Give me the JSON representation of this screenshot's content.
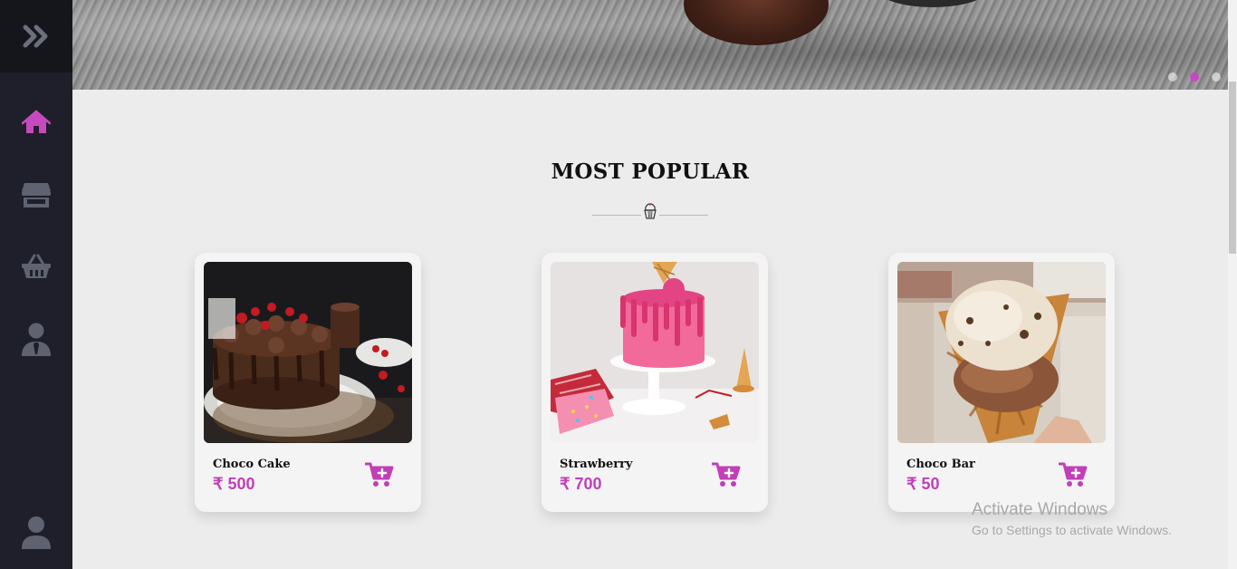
{
  "sidebar": {
    "toggle_icon": "double-chevron-right-icon",
    "items": [
      {
        "icon": "home-icon",
        "active": true
      },
      {
        "icon": "store-icon",
        "active": false
      },
      {
        "icon": "basket-icon",
        "active": false
      },
      {
        "icon": "user-tie-icon",
        "active": false
      }
    ],
    "bottom_icon": "user-icon"
  },
  "hero": {
    "slides": 3,
    "active_slide": 2
  },
  "section": {
    "title": "MOST POPULAR",
    "divider_icon": "cupcake-icon"
  },
  "products": [
    {
      "name": "Choco Cake",
      "price": "₹ 500"
    },
    {
      "name": "Strawberry",
      "price": "₹ 700"
    },
    {
      "name": "Choco Bar",
      "price": "₹ 50"
    }
  ],
  "watermark": {
    "title": "Activate Windows",
    "subtitle": "Go to Settings to activate Windows."
  },
  "colors": {
    "accent": "#c649c0",
    "sidebar": "#1e1f2a",
    "sidebar_icon": "#5f6270",
    "background": "#ececec"
  }
}
